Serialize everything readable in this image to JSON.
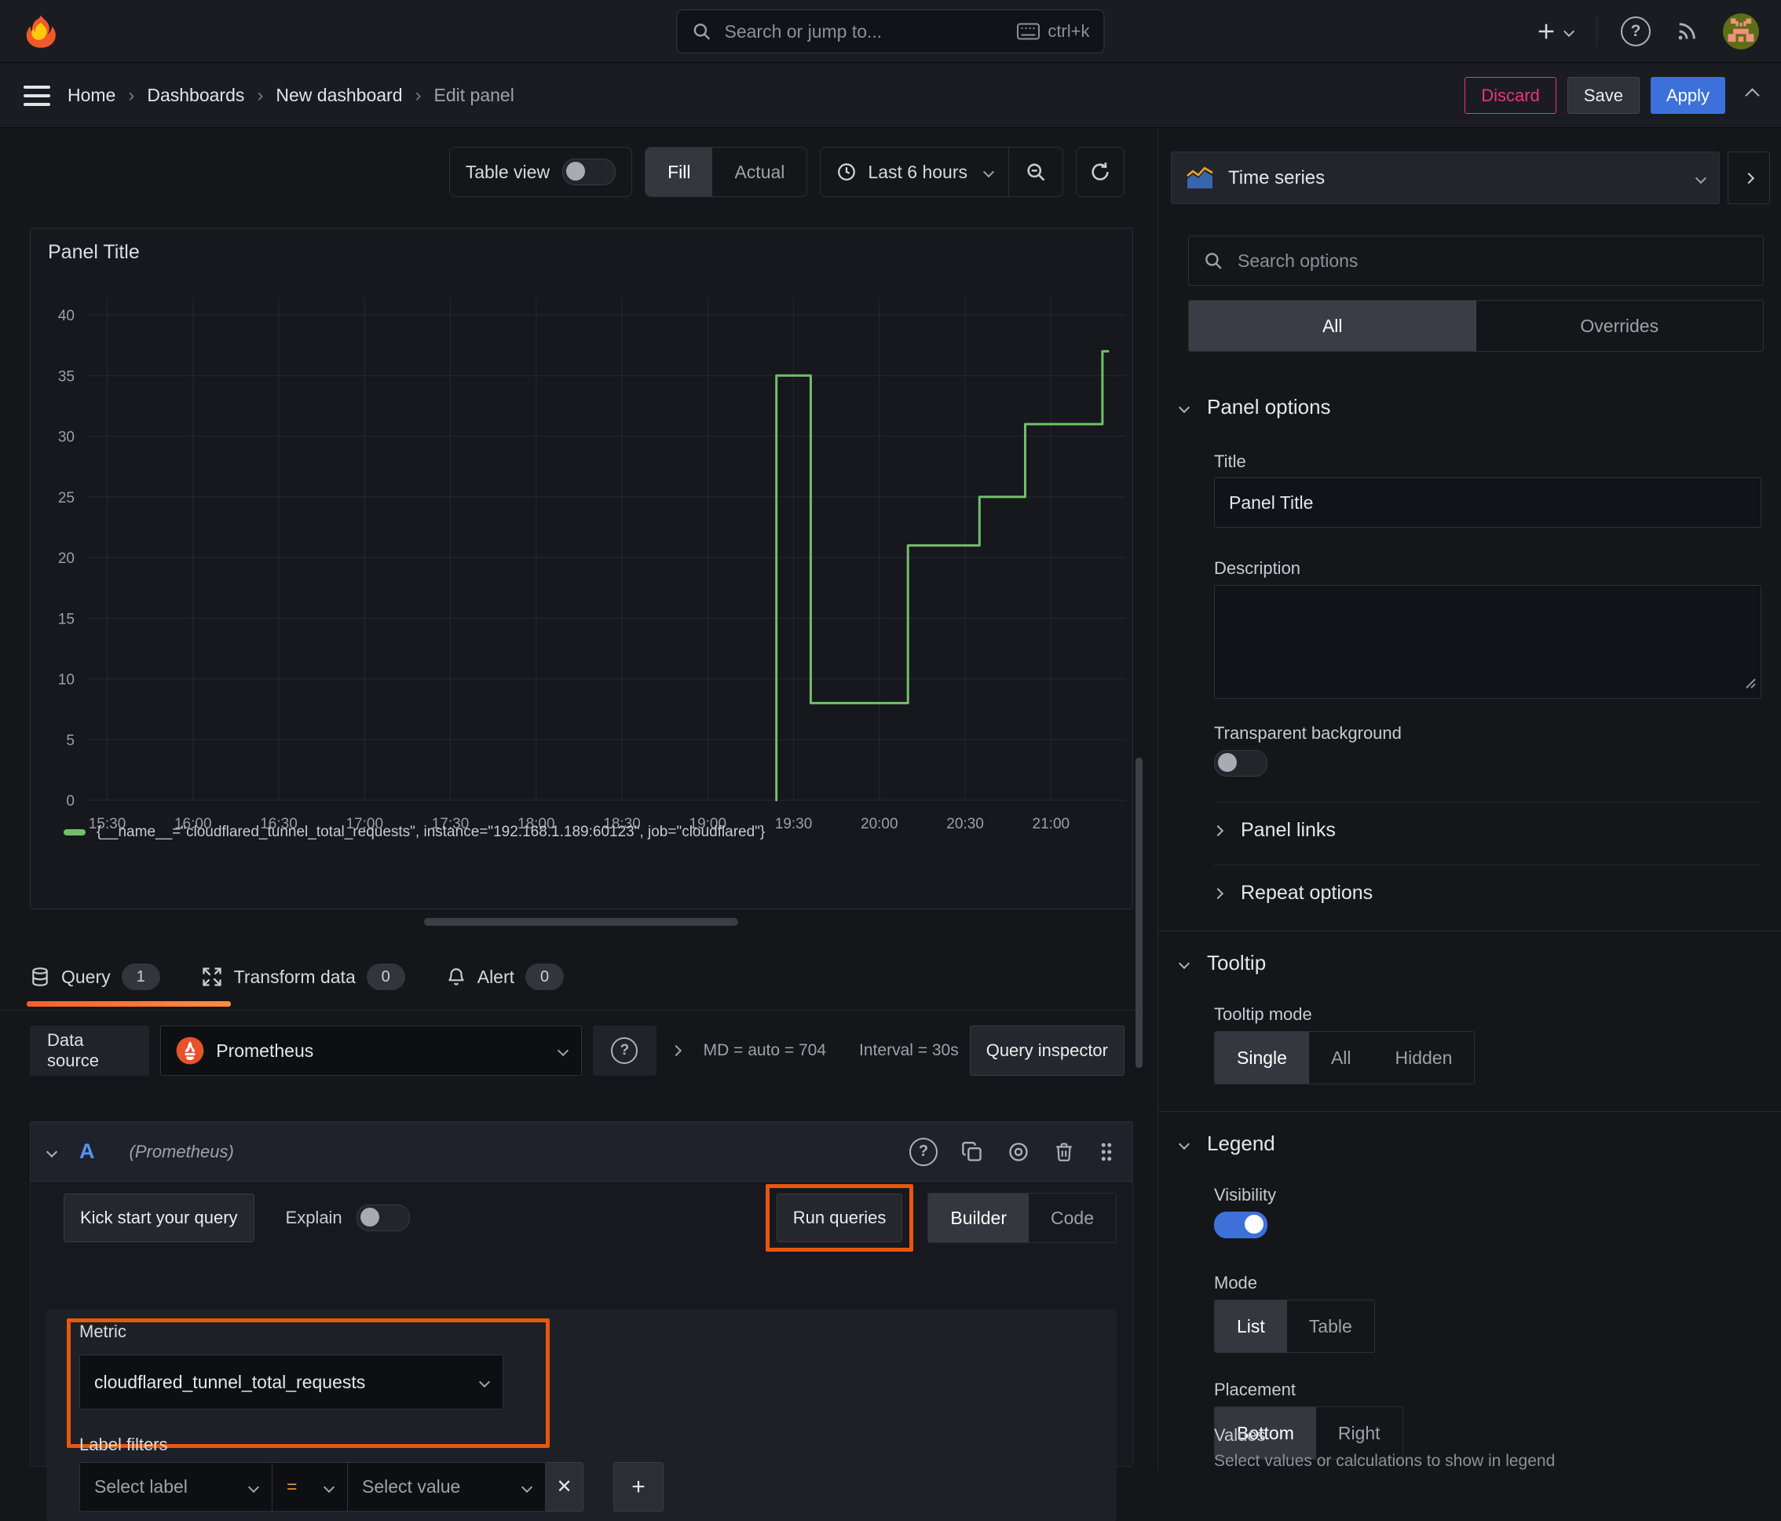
{
  "topbar": {
    "search_placeholder": "Search or jump to...",
    "search_shortcut": "ctrl+k"
  },
  "breadcrumb": {
    "items": [
      "Home",
      "Dashboards",
      "New dashboard",
      "Edit panel"
    ],
    "discard_label": "Discard",
    "save_label": "Save",
    "apply_label": "Apply"
  },
  "toolbar": {
    "table_view_label": "Table view",
    "fill_label": "Fill",
    "actual_label": "Actual",
    "time_range_label": "Last 6 hours"
  },
  "panel": {
    "title": "Panel Title"
  },
  "chart_data": {
    "type": "line",
    "title": "Panel Title",
    "xlabel": "",
    "ylabel": "",
    "ylim": [
      0,
      40
    ],
    "y_ticks": [
      0,
      5,
      10,
      15,
      20,
      25,
      30,
      35,
      40
    ],
    "x_ticks": [
      "15:30",
      "16:00",
      "16:30",
      "17:00",
      "17:30",
      "18:00",
      "18:30",
      "19:00",
      "19:30",
      "20:00",
      "20:30",
      "21:00"
    ],
    "x_domain_minutes": [
      923,
      1286
    ],
    "grid": true,
    "legend_position": "bottom",
    "series": [
      {
        "name": "{__name__=\"cloudflared_tunnel_total_requests\", instance=\"192.168.1.189:60123\", job=\"cloudflared\"}",
        "color": "#73bf69",
        "points": [
          [
            1164,
            0
          ],
          [
            1164,
            35
          ],
          [
            1176,
            35
          ],
          [
            1176,
            8
          ],
          [
            1210,
            8
          ],
          [
            1210,
            21
          ],
          [
            1235,
            21
          ],
          [
            1235,
            25
          ],
          [
            1251,
            25
          ],
          [
            1251,
            31
          ],
          [
            1278,
            31
          ],
          [
            1278,
            37
          ],
          [
            1280,
            37
          ]
        ]
      }
    ]
  },
  "tabs": {
    "query_label": "Query",
    "query_count": "1",
    "transform_label": "Transform data",
    "transform_count": "0",
    "alert_label": "Alert",
    "alert_count": "0"
  },
  "datasource_row": {
    "label": "Data source",
    "selected": "Prometheus",
    "stat_md": "MD = auto = 704",
    "stat_interval": "Interval = 30s",
    "inspector_label": "Query inspector"
  },
  "query_editor": {
    "ref_id": "A",
    "datasource_hint": "(Prometheus)",
    "kick_start_label": "Kick start your query",
    "explain_label": "Explain",
    "run_queries_label": "Run queries",
    "builder_label": "Builder",
    "code_label": "Code",
    "metric_label": "Metric",
    "metric_value": "cloudflared_tunnel_total_requests",
    "label_filters_label": "Label filters",
    "select_label_placeholder": "Select label",
    "operator": "=",
    "select_value_placeholder": "Select value"
  },
  "options_pane": {
    "viz_name": "Time series",
    "search_placeholder": "Search options",
    "tab_all": "All",
    "tab_overrides": "Overrides",
    "panel_options_header": "Panel options",
    "title_label": "Title",
    "title_value": "Panel Title",
    "description_label": "Description",
    "transparent_label": "Transparent background",
    "panel_links_header": "Panel links",
    "repeat_options_header": "Repeat options",
    "tooltip_header": "Tooltip",
    "tooltip_mode_label": "Tooltip mode",
    "tooltip_single": "Single",
    "tooltip_all": "All",
    "tooltip_hidden": "Hidden",
    "legend_header": "Legend",
    "visibility_label": "Visibility",
    "mode_label": "Mode",
    "mode_list": "List",
    "mode_table": "Table",
    "placement_label": "Placement",
    "placement_bottom": "Bottom",
    "placement_right": "Right",
    "values_label": "Values",
    "values_help": "Select values or calculations to show in legend"
  },
  "colors": {
    "accent_blue": "#3d71d9",
    "series_green": "#73bf69",
    "annotation_orange": "#e8570c",
    "discard_pink": "#e7367c",
    "prometheus_orange": "#e6522c"
  }
}
